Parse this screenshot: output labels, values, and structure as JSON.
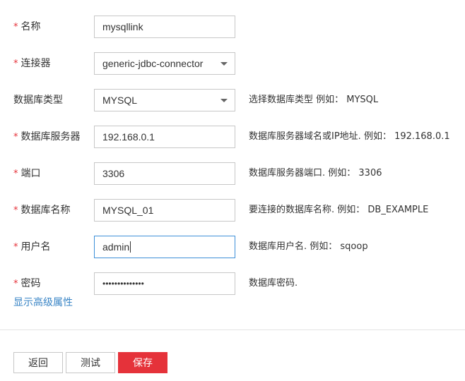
{
  "form": {
    "fields": [
      {
        "label": "名称",
        "required": true,
        "type": "text",
        "value": "mysqllink",
        "hint": ""
      },
      {
        "label": "连接器",
        "required": true,
        "type": "select",
        "value": "generic-jdbc-connector",
        "hint": ""
      },
      {
        "label": "数据库类型",
        "required": false,
        "type": "select",
        "value": "MYSQL",
        "hint": "选择数据库类型 例如： MYSQL"
      },
      {
        "label": "数据库服务器",
        "required": true,
        "type": "text",
        "value": "192.168.0.1",
        "hint": "数据库服务器域名或IP地址. 例如： 192.168.0.1"
      },
      {
        "label": "端口",
        "required": true,
        "type": "text",
        "value": "3306",
        "hint": "数据库服务器端口. 例如： 3306"
      },
      {
        "label": "数据库名称",
        "required": true,
        "type": "text",
        "value": "MYSQL_01",
        "hint": "要连接的数据库名称. 例如： DB_EXAMPLE"
      },
      {
        "label": "用户名",
        "required": true,
        "type": "text",
        "value": "admin",
        "hint": "数据库用户名. 例如： sqoop",
        "focused": true
      },
      {
        "label": "密码",
        "required": true,
        "type": "password",
        "value": "••••••••••••••",
        "hint": "数据库密码."
      }
    ],
    "required_mark": "*",
    "advanced_link": "显示高级属性"
  },
  "buttons": {
    "back": "返回",
    "test": "测试",
    "save": "保存"
  },
  "colors": {
    "accent": "#e5323a",
    "link": "#3a85c6",
    "focus_border": "#3c8fd8"
  }
}
